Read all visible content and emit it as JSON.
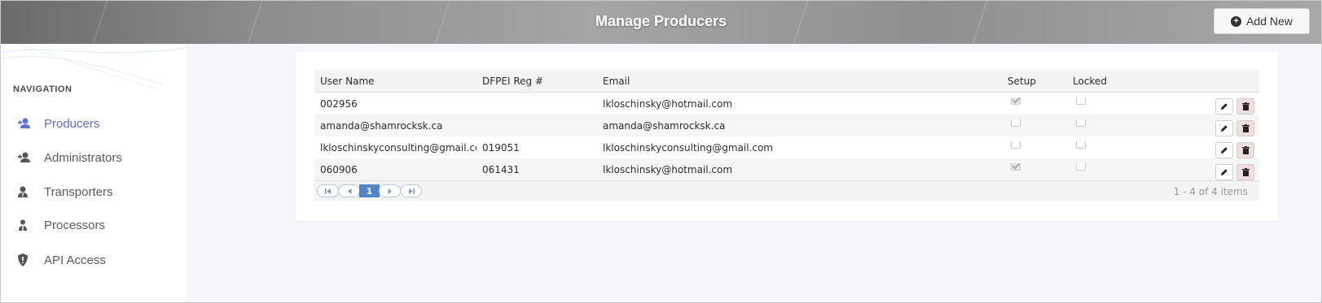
{
  "header": {
    "title": "Manage Producers",
    "add_new_label": "Add New"
  },
  "sidebar": {
    "heading": "NAVIGATION",
    "items": [
      {
        "label": "Producers",
        "icon": "user-plus-icon",
        "active": true
      },
      {
        "label": "Administrators",
        "icon": "user-plus-icon",
        "active": false
      },
      {
        "label": "Transporters",
        "icon": "user-tie-icon",
        "active": false
      },
      {
        "label": "Processors",
        "icon": "user-group-icon",
        "active": false
      },
      {
        "label": "API Access",
        "icon": "shield-icon",
        "active": false
      }
    ]
  },
  "grid": {
    "columns": [
      "User Name",
      "DFPEI Reg #",
      "Email",
      "Setup",
      "Locked"
    ],
    "rows": [
      {
        "user_name": "002956",
        "reg": "",
        "email": "lkloschinsky@hotmail.com",
        "setup": true,
        "locked": false
      },
      {
        "user_name": "amanda@shamrocksk.ca",
        "reg": "",
        "email": "amanda@shamrocksk.ca",
        "setup": false,
        "locked": false
      },
      {
        "user_name": "lkloschinskyconsulting@gmail.com",
        "reg": "019051",
        "email": "lkloschinskyconsulting@gmail.com",
        "setup": false,
        "locked": false
      },
      {
        "user_name": "060906",
        "reg": "061431",
        "email": "lkloschinsky@hotmail.com",
        "setup": true,
        "locked": false
      }
    ],
    "pager": {
      "current_page": "1",
      "info": "1 - 4 of 4 items"
    }
  },
  "colors": {
    "accent": "#5b6fd6",
    "pager_active": "#4f85c7",
    "delete_bg": "#f0dede"
  }
}
